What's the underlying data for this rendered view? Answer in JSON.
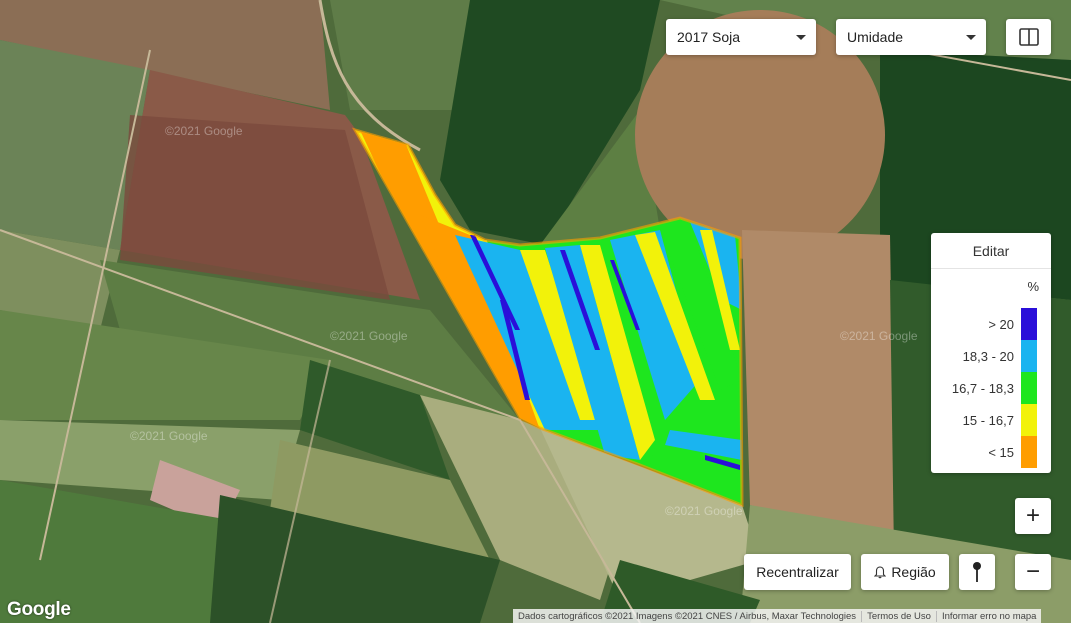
{
  "toolbar": {
    "season_select": "2017 Soja",
    "layer_select": "Umidade",
    "layout_icon": "split-view-icon"
  },
  "legend": {
    "edit_label": "Editar",
    "unit": "%",
    "classes": [
      {
        "label": "> 20",
        "color": "#2a0fd9"
      },
      {
        "label": "18,3 - 20",
        "color": "#1ab4f0"
      },
      {
        "label": "16,7 - 18,3",
        "color": "#1ee61e"
      },
      {
        "label": "15 - 16,7",
        "color": "#f2f20a"
      },
      {
        "label": "< 15",
        "color": "#ff9d00"
      }
    ]
  },
  "map_controls": {
    "zoom_in": "+",
    "zoom_out": "−",
    "recenter_label": "Recentralizar",
    "region_label": "Região",
    "region_icon": "bell-icon",
    "pin_icon": "map-pin-icon"
  },
  "basemap": {
    "google_logo": "Google",
    "watermark": "©2021 Google",
    "attribution": "Dados cartográficos ©2021 Imagens ©2021 CNES / Airbus, Maxar Technologies",
    "terms": "Termos de Uso",
    "report": "Informar erro no mapa"
  }
}
